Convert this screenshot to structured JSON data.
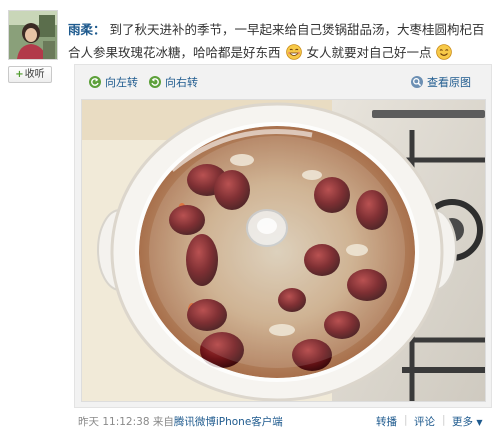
{
  "user": {
    "follow_label": "收听"
  },
  "post": {
    "author": "雨柔：",
    "text_part1": "到了秋天进补的季节，一早起来给自己煲锅甜品汤，大枣桂圆枸杞百合人参果玫瑰花冰糖，哈哈都是好东西",
    "text_part2": "女人就要对自己好一点",
    "emoji_1": "grin-emoji",
    "emoji_2": "smile-emoji"
  },
  "media_toolbar": {
    "rotate_left": "向左转",
    "rotate_right": "向右转",
    "view_original": "查看原图"
  },
  "footer": {
    "time": "昨天 11:12:38",
    "source_prefix": "来自",
    "source": "腾讯微博iPhone客户端",
    "repost": "转播",
    "comment": "评论",
    "more": "更多"
  },
  "colors": {
    "link": "#1e5a8e",
    "text": "#333333",
    "meta": "#8a8a8a"
  }
}
